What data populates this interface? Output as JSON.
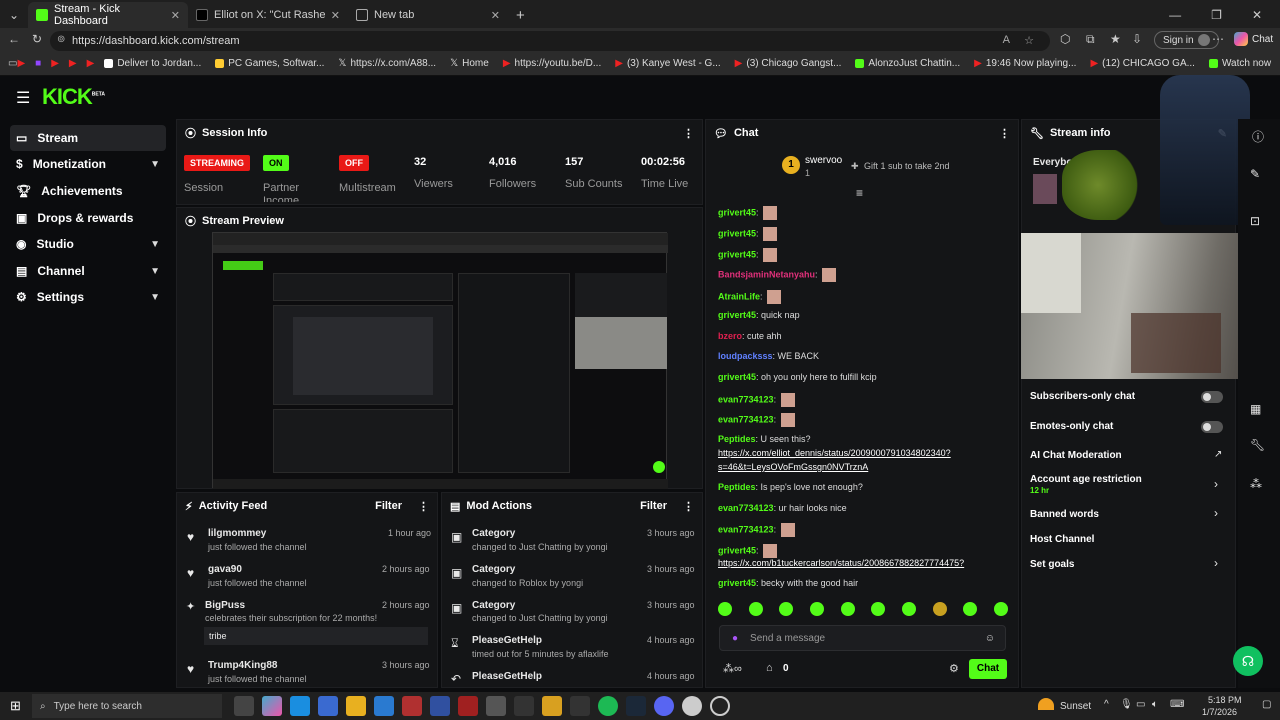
{
  "browser": {
    "tabs": [
      {
        "label": "Stream - Kick Dashboard"
      },
      {
        "label": "Elliot on X: \"Cut Rashee Rice https:"
      },
      {
        "label": "New tab"
      }
    ],
    "url": "https://dashboard.kick.com/stream",
    "signin": "Sign in",
    "chat": "Chat",
    "bookmarks": [
      "Deliver to Jordan...",
      "PC Games, Softwar...",
      "https://x.com/A88...",
      "Home",
      "https://youtu.be/D...",
      "(3) Kanye West - G...",
      "(3) Chicago Gangst...",
      "AlonzoJust Chattin...",
      "19:46 Now playing...",
      "(12) CHICAGO GA...",
      "Watch now"
    ]
  },
  "sidebar": {
    "items": [
      {
        "label": "Stream"
      },
      {
        "label": "Monetization"
      },
      {
        "label": "Achievements"
      },
      {
        "label": "Drops & rewards"
      },
      {
        "label": "Studio"
      },
      {
        "label": "Channel"
      },
      {
        "label": "Settings"
      }
    ]
  },
  "logo": "KICK",
  "logo_sup": "BETA",
  "session": {
    "title": "Session Info",
    "stats": [
      {
        "value": "STREAMING",
        "label": "Session",
        "color": "#e91916"
      },
      {
        "value": "ON",
        "label": "Partner Income",
        "color": "#53fc18"
      },
      {
        "value": "OFF",
        "label": "Multistream",
        "color": "#e91916"
      },
      {
        "value": "32",
        "label": "Viewers"
      },
      {
        "value": "4,016",
        "label": "Followers"
      },
      {
        "value": "157",
        "label": "Sub Counts"
      },
      {
        "value": "00:02:56",
        "label": "Time Live"
      }
    ]
  },
  "preview": {
    "title": "Stream Preview"
  },
  "activity": {
    "title": "Activity Feed",
    "filter": "Filter",
    "items": [
      {
        "user": "lilgmommey",
        "action": "just followed the channel",
        "time": "1 hour ago"
      },
      {
        "user": "gava90",
        "action": "just followed the channel",
        "time": "2 hours ago"
      },
      {
        "user": "BigPuss",
        "action": "celebrates their subscription for 22 months!",
        "time": "2 hours ago",
        "note": "tribe"
      },
      {
        "user": "Trump4King88",
        "action": "just followed the channel",
        "time": "3 hours ago"
      }
    ]
  },
  "mod": {
    "title": "Mod Actions",
    "filter": "Filter",
    "items": [
      {
        "title": "Category",
        "detail": "changed to Just Chatting by yongi",
        "time": "3 hours ago"
      },
      {
        "title": "Category",
        "detail": "changed to Roblox by yongi",
        "time": "3 hours ago"
      },
      {
        "title": "Category",
        "detail": "changed to Just Chatting by yongi",
        "time": "3 hours ago"
      },
      {
        "title": "PleaseGetHelp",
        "detail": "timed out for 5 minutes by aflaxlife",
        "time": "4 hours ago"
      },
      {
        "title": "PleaseGetHelp",
        "detail": "",
        "time": "4 hours ago"
      }
    ]
  },
  "chat": {
    "title": "Chat",
    "top_user": "swervoo",
    "top_count": "1",
    "gift_text": "Gift 1 sub to take 2nd",
    "placeholder": "Send a message",
    "send": "Chat",
    "count": "0",
    "messages": [
      {
        "user": "grivert45",
        "text": ""
      },
      {
        "user": "grivert45",
        "text": ""
      },
      {
        "user": "grivert45",
        "text": ""
      },
      {
        "user": "BandsjaminNetanyahu",
        "text": ""
      },
      {
        "user": "AtrainLife",
        "text": ""
      },
      {
        "user": "grivert45",
        "text": "quick nap"
      },
      {
        "user": "bzero",
        "text": "cute ahh"
      },
      {
        "user": "loudpacksss",
        "text": "WE BACK"
      },
      {
        "user": "grivert45",
        "text": "oh you only here to fulfill kcip"
      },
      {
        "user": "evan7734123",
        "text": ""
      },
      {
        "user": "evan7734123",
        "text": ""
      },
      {
        "user": "Peptides",
        "text": "U seen this?"
      },
      {
        "user": "",
        "text": "https://x.com/elliot_dennis/status/2009000791034802340?"
      },
      {
        "user": "",
        "text": "s=46&t=LeysOVoFmGssgn0NVTrznA"
      },
      {
        "user": "Peptides",
        "text": "Is pep's love not enough?"
      },
      {
        "user": "evan7734123",
        "text": "ur hair looks nice"
      },
      {
        "user": "evan7734123",
        "text": ""
      },
      {
        "user": "grivert45",
        "text": ""
      },
      {
        "user": "",
        "text": "https://x.com/b1tuckercarlson/status/2008667882827774475?"
      },
      {
        "user": "grivert45",
        "text": "becky with the good hair"
      }
    ]
  },
  "streaminfo": {
    "title": "Stream info",
    "name": "Everybod",
    "settings": [
      {
        "label": "Subscribers-only chat"
      },
      {
        "label": "Emotes-only chat"
      },
      {
        "label": "AI Chat Moderation"
      },
      {
        "label": "Account age restriction",
        "sub": "12 hr"
      },
      {
        "label": "Banned words"
      },
      {
        "label": "Host Channel"
      },
      {
        "label": "Set goals"
      }
    ]
  },
  "taskbar": {
    "search": "Type here to search",
    "weather": "Sunset",
    "time": "5:18 PM",
    "date": "1/7/2026"
  }
}
